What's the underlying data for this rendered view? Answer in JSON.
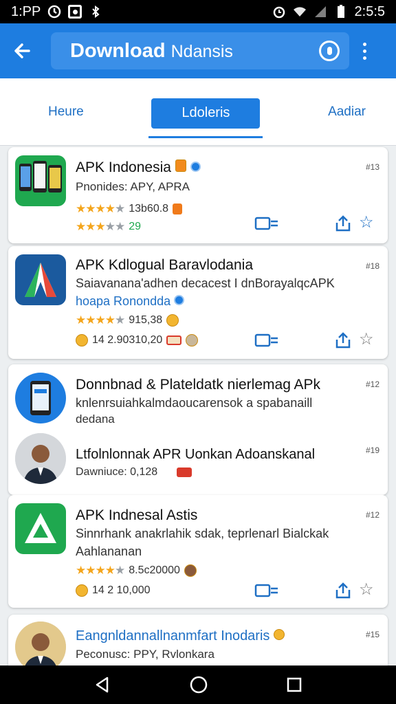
{
  "status_bar": {
    "left_text": "1:PP",
    "time": "2:5:5"
  },
  "header": {
    "title_bold": "Download",
    "title_light": "Ndansis"
  },
  "tabs": [
    {
      "label": "Heure",
      "active": false
    },
    {
      "label": "Ldoleris",
      "active": true
    },
    {
      "label": "Aadiar",
      "active": false
    }
  ],
  "cards": [
    {
      "title": "APK Indonesia",
      "sub": "Pnonides: APY, APRA",
      "rating1": "13b60.8",
      "rating2": "29",
      "meta": "#13"
    },
    {
      "title": "APK Kdlogual Baravlodania",
      "sub": "Saiavanana'adhen decacest I dnBorayalqcAPK",
      "sub2": "hoapa Ronondda",
      "rating1": "915,38",
      "rating2": "14 2.90310,20",
      "meta": "#18"
    },
    {
      "title": "Donnbnad & Plateldatk nierlemag APk",
      "sub": "knlenrsuiahkalmdaoucarensok a spabanaill",
      "sub2": "dedana",
      "meta": "#12",
      "item2_title": "Ltfolnlonnak APR Uonkan Adoanskanal",
      "item2_sub": "Dawniuce: 0,128",
      "item2_meta": "#19"
    },
    {
      "title": "APK Indnesal Astis",
      "sub": "Sinnrhank anakrlahik sdak, teprlenarl Bialckak",
      "sub2": "Aahlananan",
      "rating1": "8.5c20000",
      "rating2": "14 2 10,000",
      "meta": "#12"
    },
    {
      "title": "Eangnldannallnanmfart Inodaris",
      "sub": "Peconusc: PPY, Rvlonkara",
      "meta": "#15"
    }
  ],
  "colors": {
    "primary": "#1e7de0",
    "star": "#f4a51c",
    "green": "#1fa84f"
  }
}
